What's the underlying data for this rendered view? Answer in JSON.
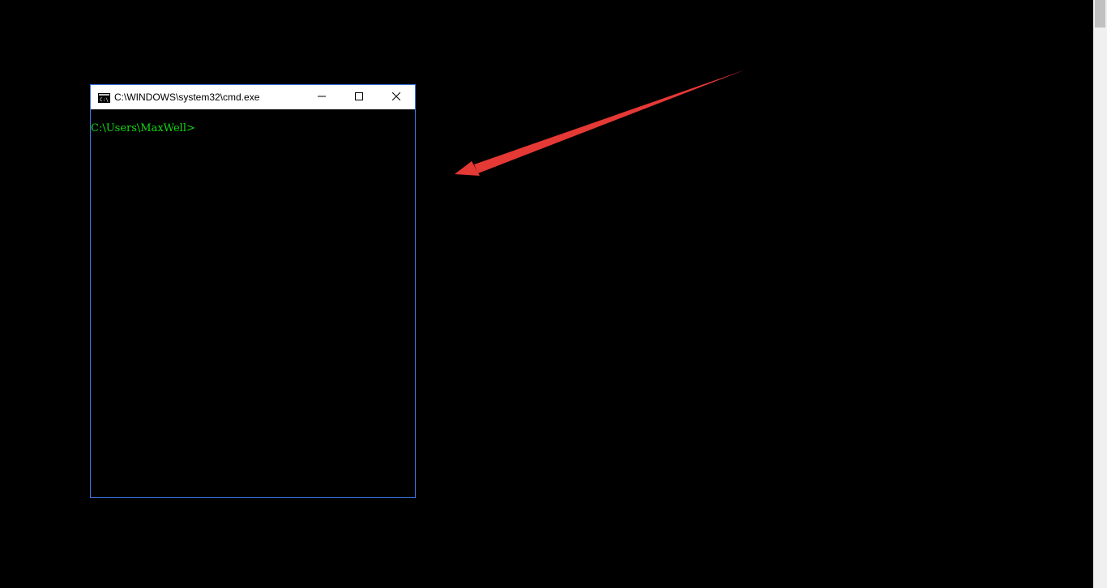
{
  "window": {
    "title": "C:\\WINDOWS\\system32\\cmd.exe",
    "app_icon": "cmd-icon",
    "controls": [
      "minimize-icon",
      "maximize-icon",
      "close-icon"
    ],
    "border_color": "#3b78e7"
  },
  "console": {
    "prompt": "C:\\Users\\MaxWell>",
    "text_color": "#13d813",
    "background": "#000000"
  },
  "annotation": {
    "arrow_color": "#e53935"
  }
}
